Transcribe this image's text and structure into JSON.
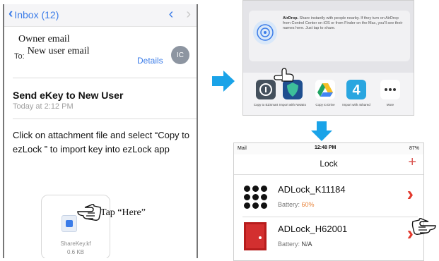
{
  "email": {
    "back_label": "Inbox (12)",
    "owner_label": "Owner email",
    "to_label": "To:",
    "new_user_label": "New user email",
    "details_label": "Details",
    "avatar_initials": "IC",
    "subject": "Send eKey to New User",
    "date": "Today at 2:12 PM",
    "body": "Click on attachment file and select “Copy to ezLock ” to import key into ezLock app",
    "attachment": {
      "name": "ShareKey.kf",
      "size": "0.6 KB"
    },
    "tap_label": "Tap “Here”"
  },
  "share": {
    "airdrop_title": "AirDrop.",
    "airdrop_text": "Share instantly with people nearby. If they turn on AirDrop from Control Center on iOS or from Finder on the Mac, you'll see their names here. Just tap to share.",
    "apps": [
      {
        "label": "Copy to EZSmart",
        "icon": "ezlock-app-icon"
      },
      {
        "label": "Import with NetaEs",
        "icon": "shield-app-icon"
      },
      {
        "label": "Copy to Drive",
        "icon": "drive-app-icon"
      },
      {
        "label": "Import with 4shared",
        "icon": "4shared-app-icon"
      },
      {
        "label": "More",
        "icon": "more-icon"
      }
    ]
  },
  "lock": {
    "status_left": "Mail",
    "status_time": "12:48 PM",
    "status_right": "87%",
    "title": "Lock",
    "items": [
      {
        "name": "ADLock_K11184",
        "battery_label": "Battery:",
        "battery_value": "60%",
        "battery_color": "#e8833a"
      },
      {
        "name": "ADLock_H62001",
        "battery_label": "Battery:",
        "battery_value": "N/A",
        "battery_color": "#333333"
      }
    ]
  },
  "colors": {
    "ios_blue": "#3b7ce8",
    "arrow_blue": "#1aa3e8",
    "accent_red": "#e2382c"
  }
}
